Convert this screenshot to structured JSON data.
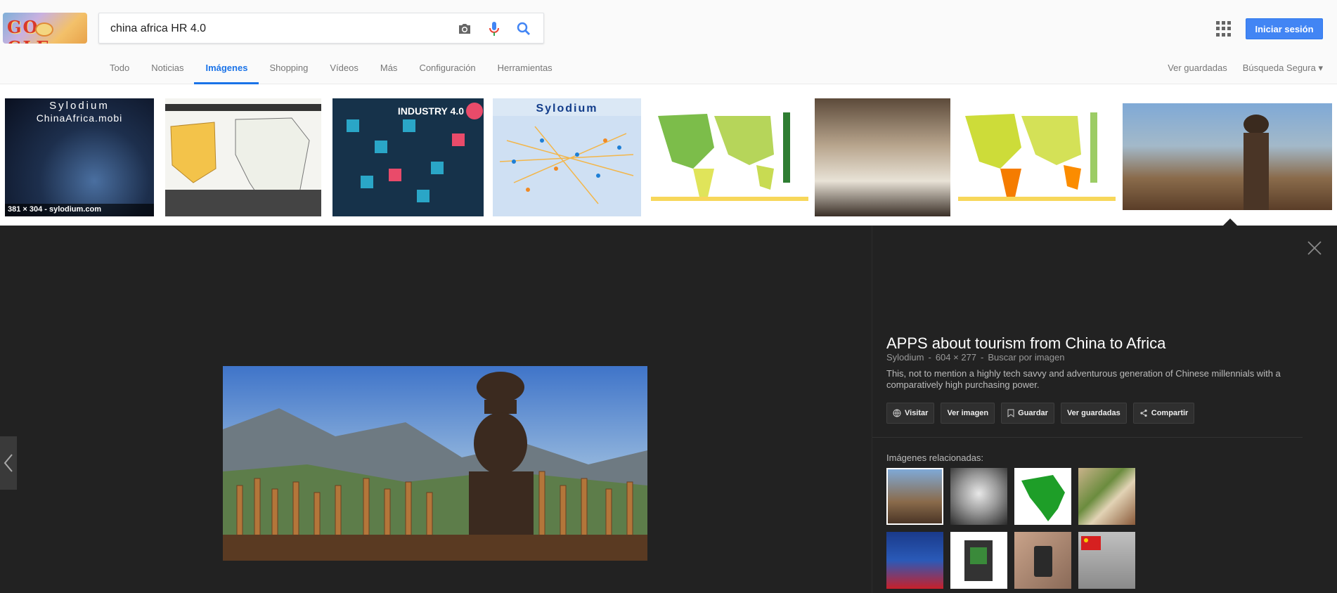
{
  "header": {
    "logo_alt": "Google doodle",
    "logo_text": "GO  GLE",
    "search_value": "china africa HR 4.0",
    "signin_label": "Iniciar sesión"
  },
  "tabs": [
    {
      "label": "Todo",
      "active": false
    },
    {
      "label": "Noticias",
      "active": false
    },
    {
      "label": "Imágenes",
      "active": true
    },
    {
      "label": "Shopping",
      "active": false
    },
    {
      "label": "Vídeos",
      "active": false
    },
    {
      "label": "Más",
      "active": false
    },
    {
      "label": "Configuración",
      "active": false
    },
    {
      "label": "Herramientas",
      "active": false
    }
  ],
  "right_links": {
    "saved": "Ver guardadas",
    "safe_search": "Búsqueda Segura ▾"
  },
  "thumbnails": {
    "first_title_1": "Sylodium",
    "first_title_2": "ChinaAfrica.mobi",
    "first_dims": "381 × 304 - sylodium.com",
    "industry_label": "INDUSTRY 4.0",
    "sylodium_map_label": "Sylodium"
  },
  "preview": {
    "title": "APPS about tourism from China to Africa",
    "source": "Sylodium",
    "dimensions": "604 × 277",
    "search_by_image": "Buscar por imagen",
    "description": "This, not to mention a highly tech savvy and adventurous generation of Chinese millennials with a comparatively high purchasing power.",
    "actions": {
      "visit": "Visitar",
      "view_image": "Ver imagen",
      "save": "Guardar",
      "view_saved": "Ver guardadas",
      "share": "Compartir"
    },
    "related_label": "Imágenes relacionadas:"
  },
  "colors": {
    "accent": "#1a73e8",
    "signin_bg": "#4285f4",
    "panel_bg": "#222222"
  }
}
